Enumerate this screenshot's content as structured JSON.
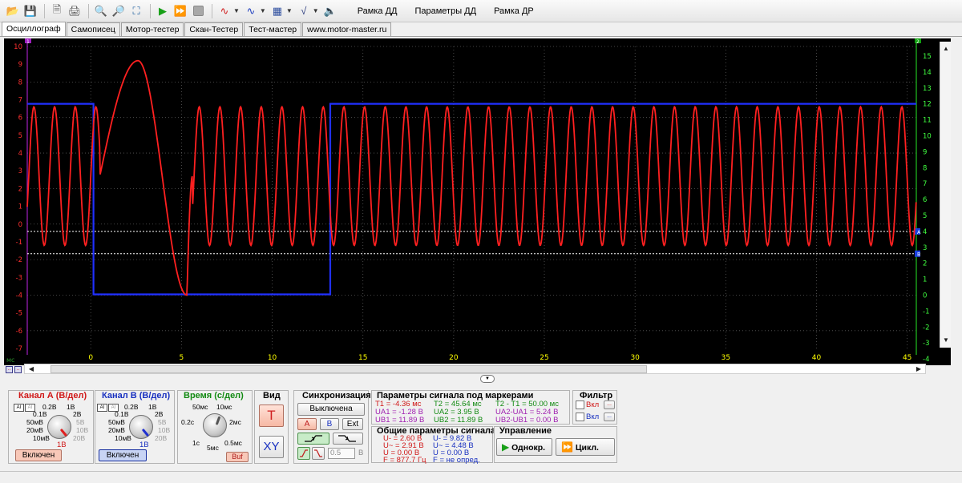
{
  "toolbar": {
    "icons": [
      "folder-open-icon",
      "save-icon",
      "print-preview-icon",
      "print-icon",
      "zoom-in-icon",
      "zoom-out-icon",
      "zoom-fit-icon",
      "play-icon",
      "play-step-icon",
      "stop-icon",
      "waveform-red-icon",
      "waveform-blue-icon",
      "calculator-icon",
      "sqrt-icon",
      "audio-icon"
    ],
    "menu": [
      "Рамка ДД",
      "Параметры ДД",
      "Рамка ДР"
    ]
  },
  "tabs": [
    "Осциллограф",
    "Самописец",
    "Мотор-тестер",
    "Скан-Тестер",
    "Тест-мастер",
    "www.motor-master.ru"
  ],
  "scope": {
    "x_unit": "мс",
    "marker_a": "A",
    "marker_b": "B",
    "left_channel_tag": "1",
    "right_channel_tag": "2",
    "colors": {
      "channel_a": "#ff2020",
      "channel_b": "#2030ff",
      "left_axis": "#ff3030",
      "right_axis": "#40ff40",
      "x_axis": "#ffff00",
      "marker": "#ffffff"
    }
  },
  "chart_data": {
    "type": "line",
    "x_range": [
      -3.5,
      45.5
    ],
    "x_ticks": [
      0,
      5,
      10,
      15,
      20,
      25,
      30,
      35,
      40,
      45
    ],
    "left_axis": {
      "range": [
        -7,
        10
      ],
      "ticks": [
        10,
        9,
        8,
        7,
        6,
        5,
        4,
        3,
        2,
        1,
        0,
        -1,
        -2,
        -3,
        -4,
        -5,
        -6,
        -7
      ]
    },
    "right_axis": {
      "range": [
        -5,
        15.5
      ],
      "ticks": [
        15,
        14,
        13,
        12,
        11,
        10,
        9,
        8,
        7,
        6,
        5,
        4,
        3,
        2,
        1,
        0,
        -1,
        -2,
        -3,
        -4
      ]
    },
    "series": [
      {
        "channel": "A",
        "axis": "left",
        "shape": "periodic",
        "period_ms": 1.139,
        "peak_v": 6.6,
        "trough_v": -1.2,
        "gap_ms": [
          0.5,
          5.6
        ],
        "gap_peak": [
          2.6,
          9.2
        ],
        "gap_trough": [
          5.3,
          -4.0
        ]
      },
      {
        "channel": "B",
        "axis": "right",
        "points": [
          [
            -3.5,
            12
          ],
          [
            0.15,
            12
          ],
          [
            0.15,
            0.05
          ],
          [
            13.2,
            0.05
          ],
          [
            13.2,
            12
          ],
          [
            45.5,
            12
          ]
        ]
      }
    ],
    "markers": [
      {
        "name": "A",
        "axis": "right",
        "y": 4.0
      },
      {
        "name": "B",
        "axis": "right",
        "y": 2.6
      }
    ]
  },
  "channel_a_panel": {
    "title": "Канал А (В/дел)",
    "scale": [
      "0.1В",
      "0.2В",
      "1В",
      "2В",
      "5В",
      "10В",
      "20В",
      "50мВ",
      "20мВ",
      "10мВ"
    ],
    "value": "1В",
    "button": "Включен"
  },
  "channel_b_panel": {
    "title": "Канал В (В/дел)",
    "scale": [
      "0.1В",
      "0.2В",
      "1В",
      "2В",
      "5В",
      "10В",
      "20В",
      "50мВ",
      "20мВ",
      "10мВ"
    ],
    "value": "1В",
    "button": "Включен"
  },
  "time_panel": {
    "title": "Время (с/дел)",
    "scale": [
      "50мс",
      "10мс",
      "0.2с",
      "2мс",
      "1с",
      "0.5мс",
      "5мс"
    ],
    "button": "Buf"
  },
  "view_panel": {
    "title": "Вид",
    "t": "T",
    "xy": "XY"
  },
  "sync_panel": {
    "title": "Синхронизация",
    "state": "Выключена",
    "sources": [
      "A",
      "B",
      "Ext"
    ],
    "level": "0.5",
    "unit": "В"
  },
  "marker_params": {
    "title": "Параметры сигнала под маркерами",
    "t1": "T1 = -4.36 мс",
    "ua1": "UA1 = -1.28 В",
    "ub1": "UB1 = 11.89 В",
    "t2": "T2 = 45.64 мс",
    "ua2": "UA2 = 3.95 В",
    "ub2": "UB2 = 11.89 В",
    "dt": "T2 - T1 = 50.00 мс",
    "dua": "UA2-UA1 = 5.24 В",
    "dub": "UB2-UB1 = 0.00 В"
  },
  "filter_panel": {
    "title": "Фильтр",
    "items": [
      "Вкл",
      "Вкл"
    ]
  },
  "general_params": {
    "title": "Общие параметры сигнала",
    "a": [
      "U- = 2.60 В",
      "U~ = 2.91 В",
      "U = 0.00 В",
      "F = 877.7 Гц"
    ],
    "b": [
      "U- = 9.82 В",
      "U~ = 4.48 В",
      "U = 0.00 В",
      "F = не опред."
    ]
  },
  "control_panel": {
    "title": "Управление",
    "single": "Однокр.",
    "cycle": "Цикл."
  }
}
